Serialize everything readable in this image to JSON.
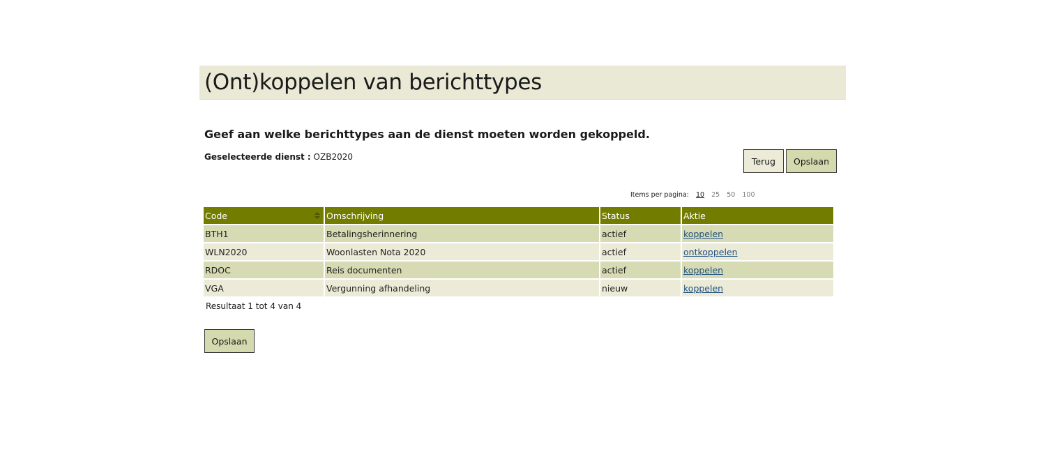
{
  "header": {
    "title": "(Ont)koppelen van berichttypes"
  },
  "intro": {
    "subtitle": "Geef aan welke berichttypes aan de dienst moeten worden gekoppeld.",
    "selected_label": "Geselecteerde dienst :",
    "selected_value": "OZB2020"
  },
  "actions": {
    "back_label": "Terug",
    "save_label": "Opslaan"
  },
  "pagination": {
    "label": "Items per pagina:",
    "options": [
      "10",
      "25",
      "50",
      "100"
    ],
    "selected": "10"
  },
  "table": {
    "columns": [
      "Code",
      "Omschrijving",
      "Status",
      "Aktie"
    ],
    "rows": [
      {
        "code": "BTH1",
        "omschrijving": "Betalingsherinnering",
        "status": "actief",
        "aktie": "koppelen"
      },
      {
        "code": "WLN2020",
        "omschrijving": "Woonlasten Nota 2020",
        "status": "actief",
        "aktie": "ontkoppelen"
      },
      {
        "code": "RDOC",
        "omschrijving": "Reis documenten",
        "status": "actief",
        "aktie": "koppelen"
      },
      {
        "code": "VGA",
        "omschrijving": "Vergunning afhandeling",
        "status": "nieuw",
        "aktie": "koppelen"
      }
    ],
    "result_text": "Resultaat 1 tot 4 van 4"
  },
  "colors": {
    "title_bg": "#e9e9d6",
    "header_bg": "#727d00",
    "row_odd": "#d7dbb3",
    "row_even": "#ebebd7",
    "link": "#1f4f80"
  }
}
